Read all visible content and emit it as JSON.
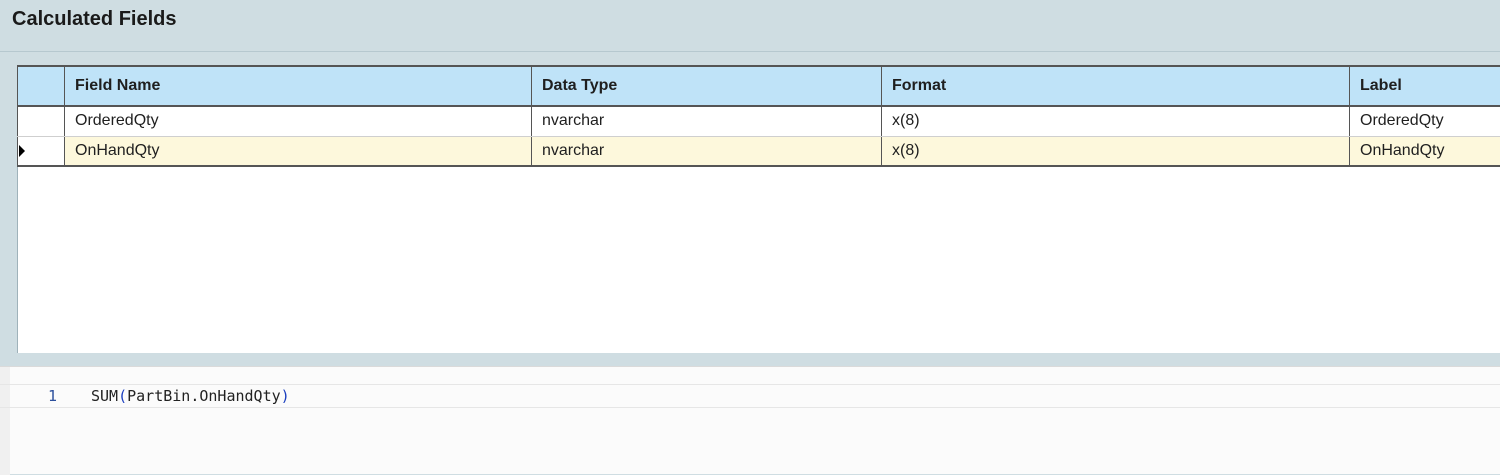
{
  "header": {
    "title": "Calculated Fields"
  },
  "grid": {
    "columns": [
      "Field Name",
      "Data Type",
      "Format",
      "Label"
    ],
    "rows": [
      {
        "field_name": "OrderedQty",
        "data_type": "nvarchar",
        "format": "x(8)",
        "label": "OrderedQty",
        "selected": false
      },
      {
        "field_name": "OnHandQty",
        "data_type": "nvarchar",
        "format": "x(8)",
        "label": "OnHandQty",
        "selected": true
      }
    ]
  },
  "editor": {
    "line_number": "1",
    "code_prefix": "SUM",
    "code_open": "(",
    "code_body": "PartBin.OnHandQty",
    "code_close": ")"
  },
  "icons": {
    "row_indicator": "triangle-right-icon",
    "splitter_grip": "grip-icon"
  },
  "colors": {
    "header_bg": "#cfdde2",
    "grid_header_bg": "#bfe3f8",
    "selected_row_bg": "#fdf8dc",
    "line_number": "#2b4f9c"
  }
}
